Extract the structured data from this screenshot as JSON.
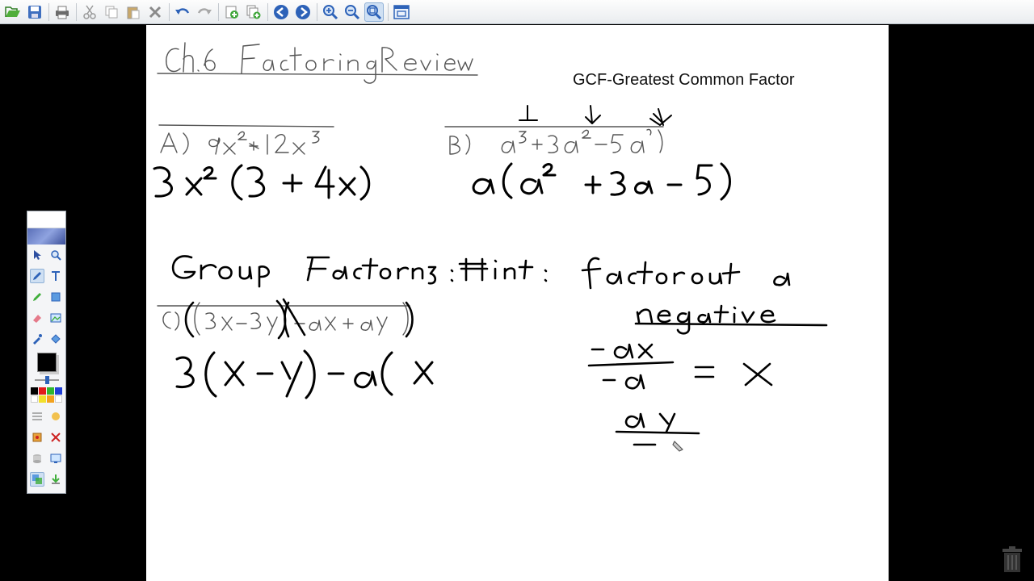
{
  "page": {
    "gcf_label": "GCF-Greatest Common Factor"
  },
  "toolbar": {
    "buttons": [
      {
        "name": "open-icon",
        "color": "#3f9b2f"
      },
      {
        "name": "save-icon",
        "color": "#3f6fbf"
      },
      {
        "name": "print-icon",
        "color": "#555"
      },
      {
        "name": "cut-icon",
        "color": "#888"
      },
      {
        "name": "copy-icon",
        "color": "#888"
      },
      {
        "name": "paste-icon",
        "color": "#888"
      },
      {
        "name": "delete-icon",
        "color": "#888"
      },
      {
        "name": "undo-icon",
        "color": "#2d62b8"
      },
      {
        "name": "redo-icon",
        "color": "#999"
      },
      {
        "name": "add-page-icon",
        "color": "#3f9b2f"
      },
      {
        "name": "add-page-copy-icon",
        "color": "#3f9b2f"
      },
      {
        "name": "previous-page-icon",
        "color": "#2d62b8"
      },
      {
        "name": "next-page-icon",
        "color": "#2d62b8"
      },
      {
        "name": "zoom-in-icon",
        "color": "#2d62b8"
      },
      {
        "name": "zoom-out-icon",
        "color": "#2d62b8"
      },
      {
        "name": "zoom-fit-icon",
        "color": "#2d62b8"
      },
      {
        "name": "screen-display-icon",
        "color": "#2d62b8"
      }
    ]
  },
  "palette": {
    "current_color": "#000000",
    "swatch_colors": [
      "#000000",
      "#e21b1b",
      "#2fb52f",
      "#1f3fd6",
      "#ffffff",
      "#f2e02b",
      "#f3a21e",
      "#ffffff"
    ]
  }
}
